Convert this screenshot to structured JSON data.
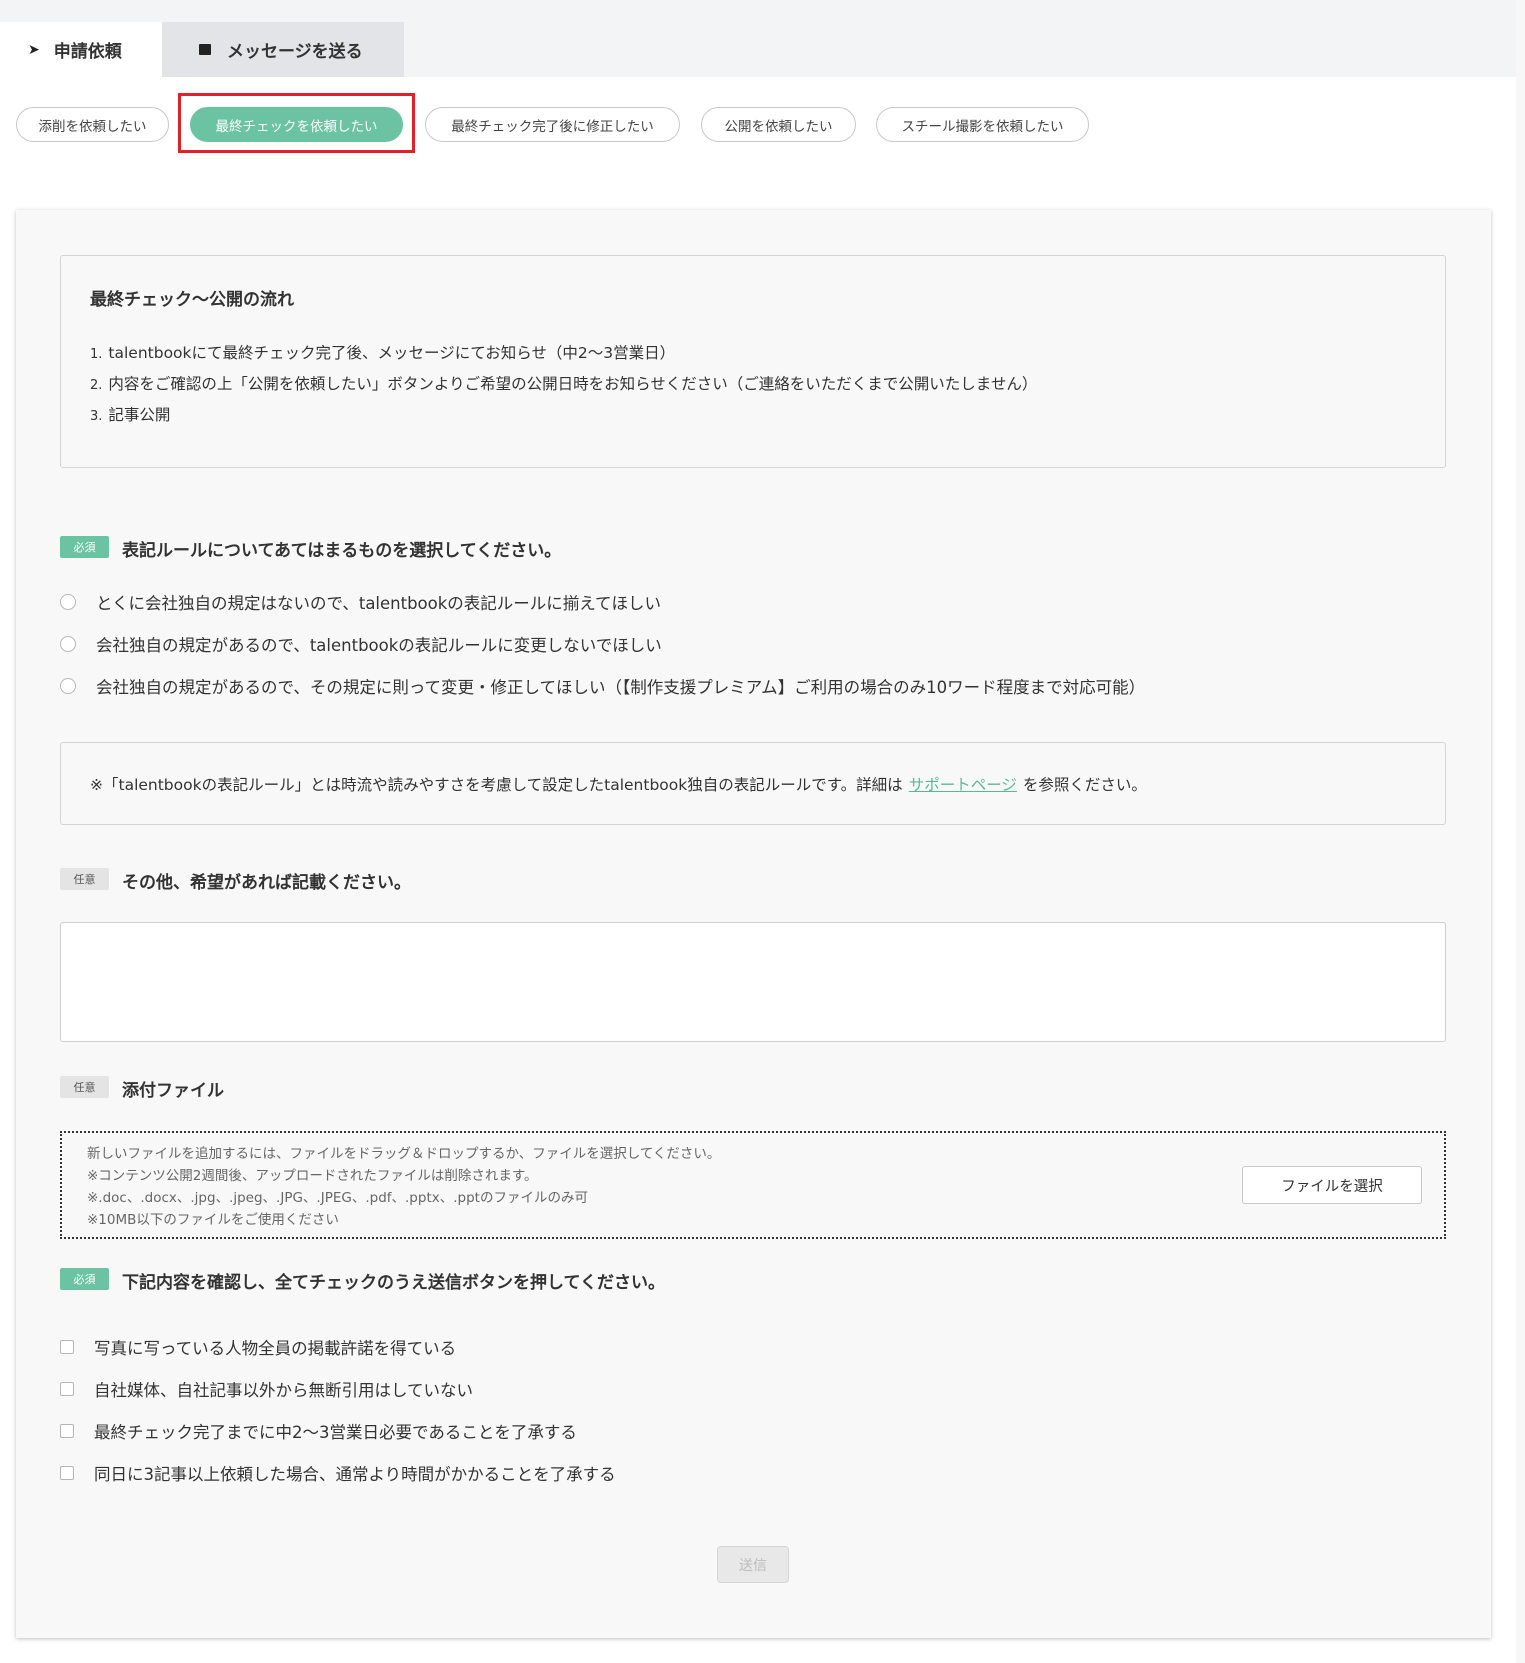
{
  "tabs": {
    "request": {
      "label": "申請依頼",
      "icon": "chevron-right-icon"
    },
    "message": {
      "label": "メッセージを送る",
      "icon": "message-square-icon"
    }
  },
  "request_types": [
    {
      "label": "添削を依頼したい",
      "active": false
    },
    {
      "label": "最終チェックを依頼したい",
      "active": true
    },
    {
      "label": "最終チェック完了後に修正したい",
      "active": false
    },
    {
      "label": "公開を依頼したい",
      "active": false
    },
    {
      "label": "スチール撮影を依頼したい",
      "active": false
    }
  ],
  "flow": {
    "title": "最終チェック～公開の流れ",
    "steps": [
      {
        "num": "1.",
        "text": "talentbookにて最終チェック完了後、メッセージにてお知らせ（中2～3営業日）"
      },
      {
        "num": "2.",
        "text": "内容をご確認の上「公開を依頼したい」ボタンよりご希望の公開日時をお知らせください（ご連絡をいただくまで公開いたしません）"
      },
      {
        "num": "3.",
        "text": "記事公開"
      }
    ]
  },
  "notation": {
    "badge": "必須",
    "label": "表記ルールについてあてはまるものを選択してください。",
    "options": [
      "とくに会社独自の規定はないので、talentbookの表記ルールに揃えてほしい",
      "会社独自の規定があるので、talentbookの表記ルールに変更しないでほしい",
      "会社独自の規定があるので、その規定に則って変更・修正してほしい（【制作支援プレミアム】ご利用の場合のみ10ワード程度まで対応可能）"
    ],
    "note_before": "※「talentbookの表記ルール」とは時流や読みやすさを考慮して設定したtalentbook独自の表記ルールです。詳細は",
    "note_link": "サポートページ",
    "note_after": "を参照ください。"
  },
  "other": {
    "badge": "任意",
    "label": "その他、希望があれば記載ください。",
    "value": ""
  },
  "attachment": {
    "badge": "任意",
    "label": "添付ファイル",
    "lines": [
      "新しいファイルを追加するには、ファイルをドラッグ＆ドロップするか、ファイルを選択してください。",
      "※コンテンツ公開2週間後、アップロードされたファイルは削除されます。",
      "※.doc、.docx、.jpg、.jpeg、.JPG、.JPEG、.pdf、.pptx、.pptのファイルのみ可",
      "※10MB以下のファイルをご使用ください"
    ],
    "button": "ファイルを選択"
  },
  "confirm": {
    "badge": "必須",
    "label": "下記内容を確認し、全てチェックのうえ送信ボタンを押してください。",
    "items": [
      "写真に写っている人物全員の掲載許諾を得ている",
      "自社媒体、自社記事以外から無断引用はしていない",
      "最終チェック完了までに中2～3営業日必要であることを了承する",
      "同日に3記事以上依頼した場合、通常より時間がかかることを了承する"
    ]
  },
  "submit": {
    "label": "送信",
    "enabled": false
  },
  "colors": {
    "accent": "#6cc3a4",
    "highlight": "#e0202a"
  }
}
